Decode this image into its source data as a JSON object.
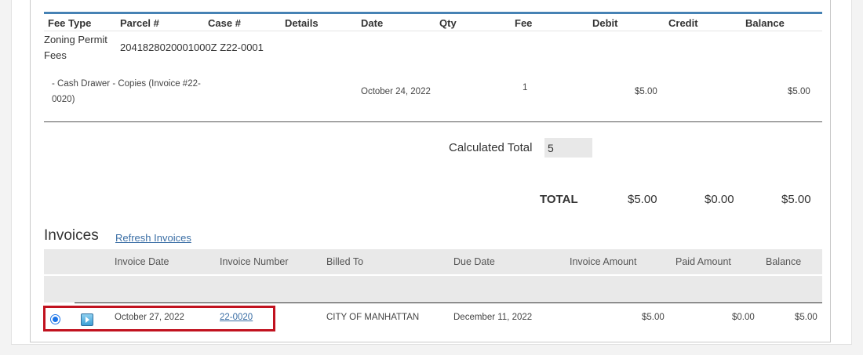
{
  "fees_table": {
    "headers": [
      "Fee Type",
      "Parcel #",
      "Case #",
      "Details",
      "Date",
      "Qty",
      "Fee",
      "Debit",
      "Credit",
      "Balance"
    ],
    "fee_type_line1": "Zoning Permit",
    "fee_type_line2": "Fees",
    "parcel_case": "2041828020001000Z Z22-0001",
    "row": {
      "details_line1": "- Cash Drawer - Copies (Invoice #22-",
      "details_line2": "0020)",
      "date": "October 24, 2022",
      "qty": "1",
      "debit": "$5.00",
      "balance": "$5.00"
    }
  },
  "calculated_total": {
    "label": "Calculated Total",
    "value": "5"
  },
  "totals": {
    "label": "TOTAL",
    "debit": "$5.00",
    "credit": "$0.00",
    "balance": "$5.00"
  },
  "invoices": {
    "title": "Invoices",
    "refresh_label": "Refresh Invoices",
    "headers": [
      "Invoice Date",
      "Invoice Number",
      "Billed To",
      "Due Date",
      "Invoice Amount",
      "Paid Amount",
      "Balance"
    ],
    "rows": [
      {
        "invoice_date": "October 27, 2022",
        "invoice_number": "22-0020",
        "billed_to": "CITY OF MANHATTAN",
        "due_date": "December 11, 2022",
        "invoice_amount": "$5.00",
        "paid_amount": "$0.00",
        "balance": "$5.00",
        "selected": true
      }
    ]
  },
  "colors": {
    "accent": "#4682b4",
    "highlight": "#c1121f",
    "link": "#3a6ea5"
  }
}
